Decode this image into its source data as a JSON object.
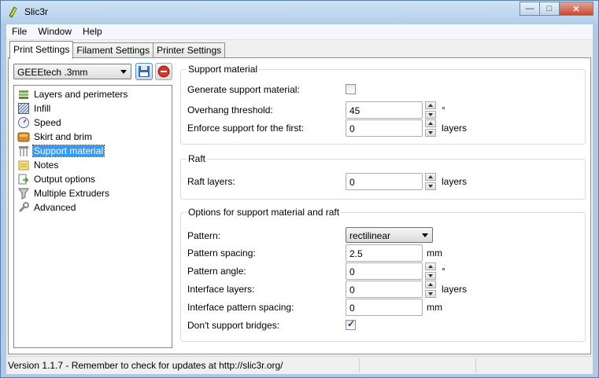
{
  "window": {
    "title": "Slic3r",
    "controls": {
      "minimize": "—",
      "maximize": "□",
      "close": "✕"
    }
  },
  "menubar": {
    "items": [
      "File",
      "Window",
      "Help"
    ]
  },
  "tabs": [
    "Print Settings",
    "Filament Settings",
    "Printer Settings"
  ],
  "preset": {
    "selected": "GEEEtech .3mm"
  },
  "sidebar": {
    "items": [
      {
        "label": "Layers and perimeters",
        "icon": "layers-icon"
      },
      {
        "label": "Infill",
        "icon": "infill-icon"
      },
      {
        "label": "Speed",
        "icon": "speed-icon"
      },
      {
        "label": "Skirt and brim",
        "icon": "skirt-icon"
      },
      {
        "label": "Support material",
        "icon": "support-icon",
        "selected": true
      },
      {
        "label": "Notes",
        "icon": "notes-icon"
      },
      {
        "label": "Output options",
        "icon": "output-icon"
      },
      {
        "label": "Multiple Extruders",
        "icon": "extruders-icon"
      },
      {
        "label": "Advanced",
        "icon": "wrench-icon"
      }
    ]
  },
  "support": {
    "title": "Support material",
    "generate_label": "Generate support material:",
    "generate_checked": false,
    "overhang_label": "Overhang threshold:",
    "overhang_value": "45",
    "overhang_unit": "°",
    "enforce_label": "Enforce support for the first:",
    "enforce_value": "0",
    "enforce_unit": "layers"
  },
  "raft": {
    "title": "Raft",
    "layers_label": "Raft layers:",
    "layers_value": "0",
    "layers_unit": "layers"
  },
  "options": {
    "title": "Options for support material and raft",
    "pattern_label": "Pattern:",
    "pattern_value": "rectilinear",
    "spacing_label": "Pattern spacing:",
    "spacing_value": "2.5",
    "spacing_unit": "mm",
    "angle_label": "Pattern angle:",
    "angle_value": "0",
    "angle_unit": "°",
    "interface_layers_label": "Interface layers:",
    "interface_layers_value": "0",
    "interface_layers_unit": "layers",
    "interface_spacing_label": "Interface pattern spacing:",
    "interface_spacing_value": "0",
    "interface_spacing_unit": "mm",
    "bridges_label": "Don't support bridges:",
    "bridges_checked": true,
    "check_glyph": "✓"
  },
  "status": {
    "text": "Version 1.1.7 - Remember to check for updates at http://slic3r.org/"
  }
}
